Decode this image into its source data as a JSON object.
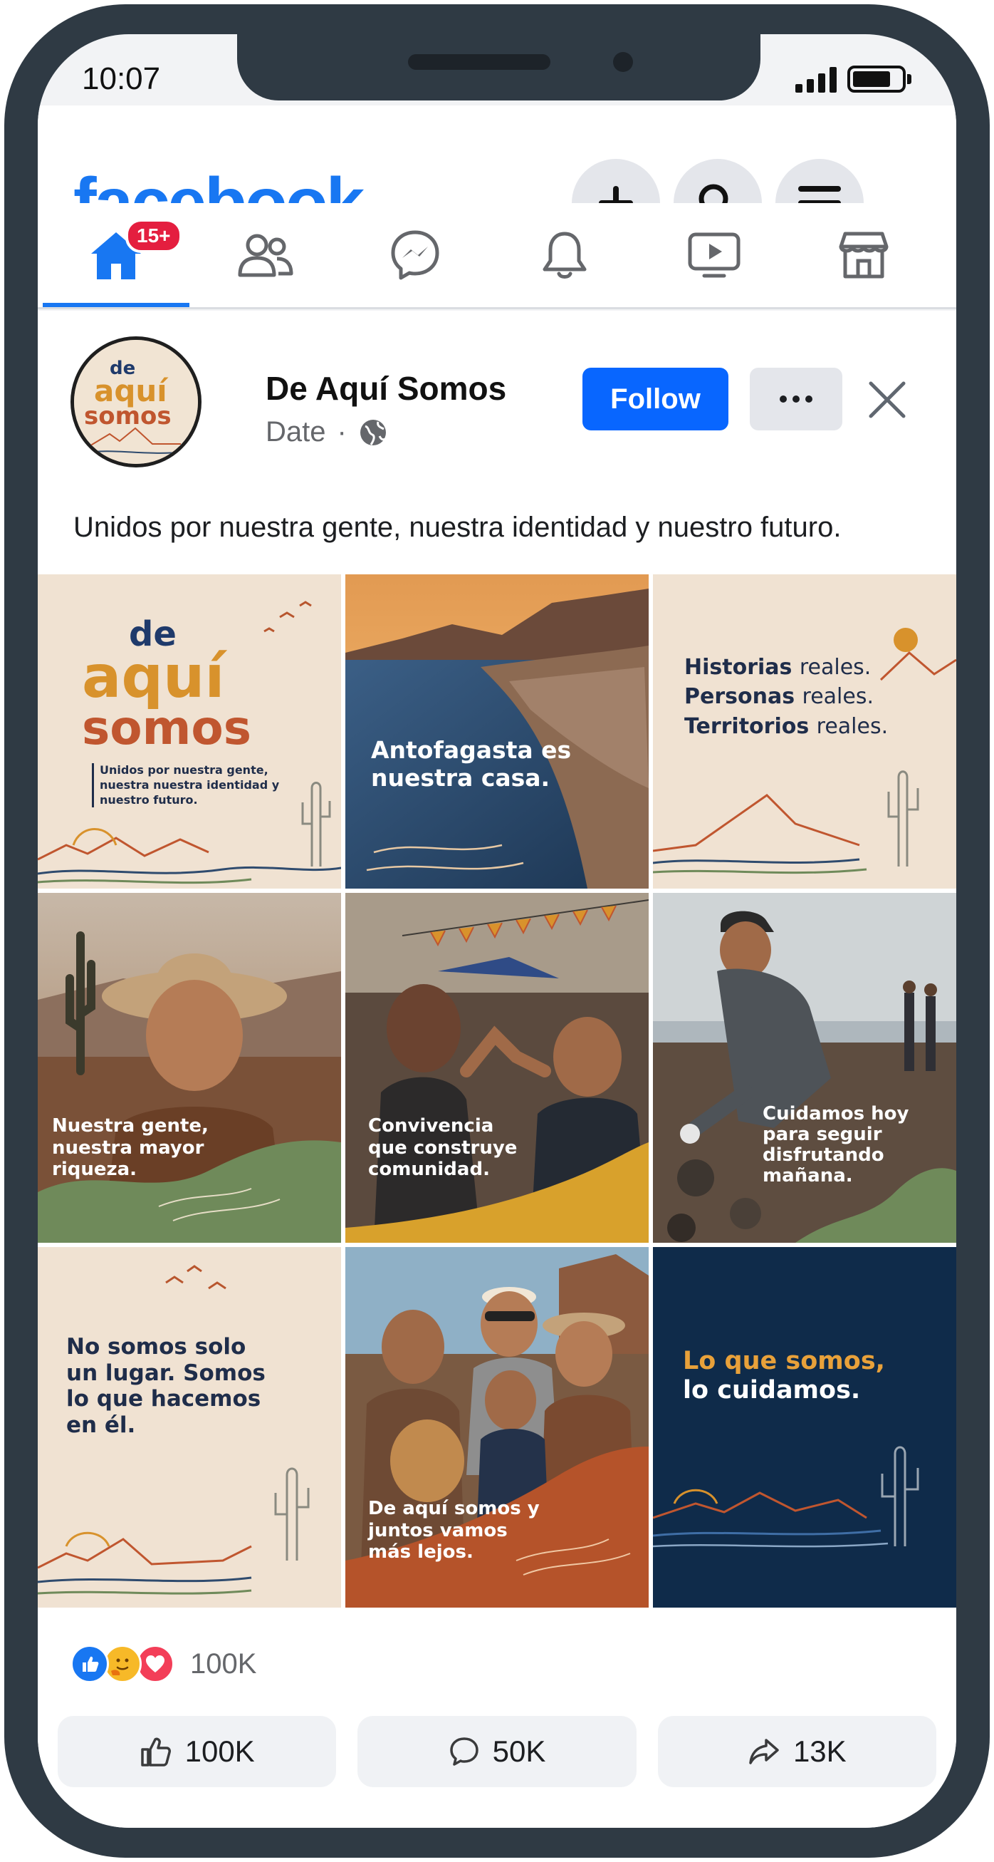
{
  "status_bar": {
    "time": "10:07"
  },
  "app": {
    "logo": "facebook"
  },
  "header_buttons": [
    {
      "name": "create",
      "icon": "plus-icon"
    },
    {
      "name": "search",
      "icon": "search-icon"
    },
    {
      "name": "menu",
      "icon": "menu-icon"
    }
  ],
  "nav": {
    "tabs": [
      {
        "id": "home",
        "icon": "home-icon",
        "active": true
      },
      {
        "id": "friends",
        "icon": "friends-icon"
      },
      {
        "id": "messenger",
        "icon": "messenger-icon"
      },
      {
        "id": "notifications",
        "icon": "bell-icon"
      },
      {
        "id": "video",
        "icon": "video-icon"
      },
      {
        "id": "marketplace",
        "icon": "marketplace-icon"
      }
    ],
    "home_badge": "15+"
  },
  "post": {
    "avatar_logo": {
      "line1": "de",
      "line2": "aquí",
      "line3": "somos"
    },
    "page_name": "De Aquí Somos",
    "date": "Date",
    "separator": "·",
    "follow_label": "Follow",
    "caption": "Unidos por nuestra gente, nuestra identidad y nuestro futuro.",
    "tiles": [
      {
        "logo_line1": "de",
        "logo_line2": "aquí",
        "logo_line3": "somos",
        "tagline": "Unidos por nuestra gente, nuestra nuestra identidad y nuestro futuro."
      },
      {
        "text": "Antofagasta es nuestra casa."
      },
      {
        "line1_bold": "Historias",
        "line1_rest": "reales.",
        "line2_bold": "Personas",
        "line2_rest": "reales.",
        "line3_bold": "Territorios",
        "line3_rest": "reales."
      },
      {
        "text": "Nuestra gente, nuestra mayor riqueza."
      },
      {
        "text": "Convivencia que construye comunidad."
      },
      {
        "text": "Cuidamos hoy para seguir disfrutando mañana."
      },
      {
        "text": "No somos solo un lugar. Somos lo que hacemos en él."
      },
      {
        "text": "De aquí somos y juntos vamos más lejos."
      },
      {
        "line1": "Lo que somos,",
        "line2": "lo cuidamos."
      }
    ],
    "reactions": {
      "icons": [
        "like-icon",
        "care-icon",
        "love-icon"
      ],
      "count": "100K"
    },
    "actions": [
      {
        "name": "like",
        "icon": "thumbs-up-icon",
        "count": "100K"
      },
      {
        "name": "comment",
        "icon": "comment-icon",
        "count": "50K"
      },
      {
        "name": "share",
        "icon": "share-icon",
        "count": "13K"
      }
    ]
  },
  "colors": {
    "brand": "#1877f2",
    "follow": "#0866ff",
    "badge": "#e41e3f",
    "frame": "#2f3a44"
  }
}
